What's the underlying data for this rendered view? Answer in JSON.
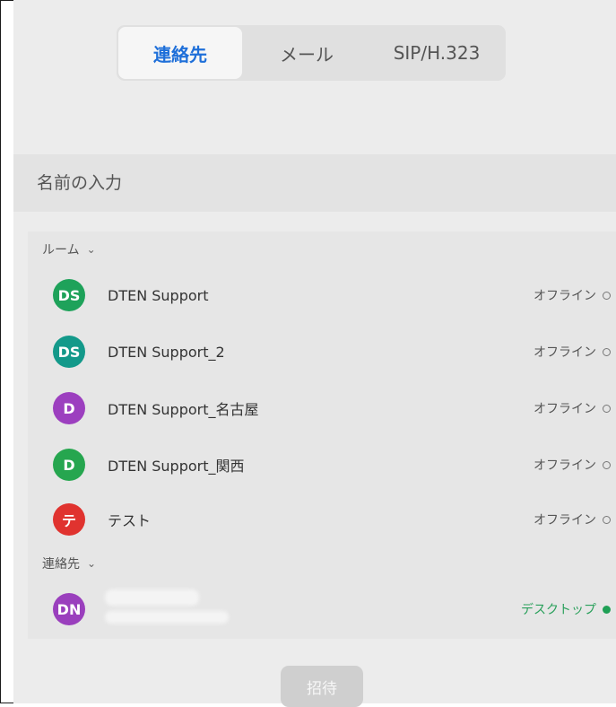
{
  "tabs": [
    {
      "label": "連絡先",
      "active": true
    },
    {
      "label": "メール",
      "active": false
    },
    {
      "label": "SIP/H.323",
      "active": false
    }
  ],
  "search": {
    "placeholder": "名前の入力"
  },
  "sections": {
    "rooms": {
      "label": "ルーム",
      "chevron": "chevron-down-icon"
    },
    "contacts": {
      "label": "連絡先",
      "chevron": "chevron-down-icon"
    }
  },
  "rooms": [
    {
      "initials": "DS",
      "name": "DTEN Support",
      "status": "オフライン",
      "color": "#1ea25a"
    },
    {
      "initials": "DS",
      "name": "DTEN Support_2",
      "status": "オフライン",
      "color": "#13998a"
    },
    {
      "initials": "D",
      "name": "DTEN Support_名古屋",
      "status": "オフライン",
      "color": "#9c3fbf"
    },
    {
      "initials": "D",
      "name": "DTEN Support_関西",
      "status": "オフライン",
      "color": "#26a64f"
    },
    {
      "initials": "テ",
      "name": "テスト",
      "status": "オフライン",
      "color": "#e0332f"
    }
  ],
  "contacts": [
    {
      "initials": "DN",
      "status": "デスクトップ",
      "color": "#9a3fbd"
    }
  ],
  "invite_label": "招待",
  "colors": {
    "accent": "#1e6fd9",
    "online": "#2aa05b"
  }
}
